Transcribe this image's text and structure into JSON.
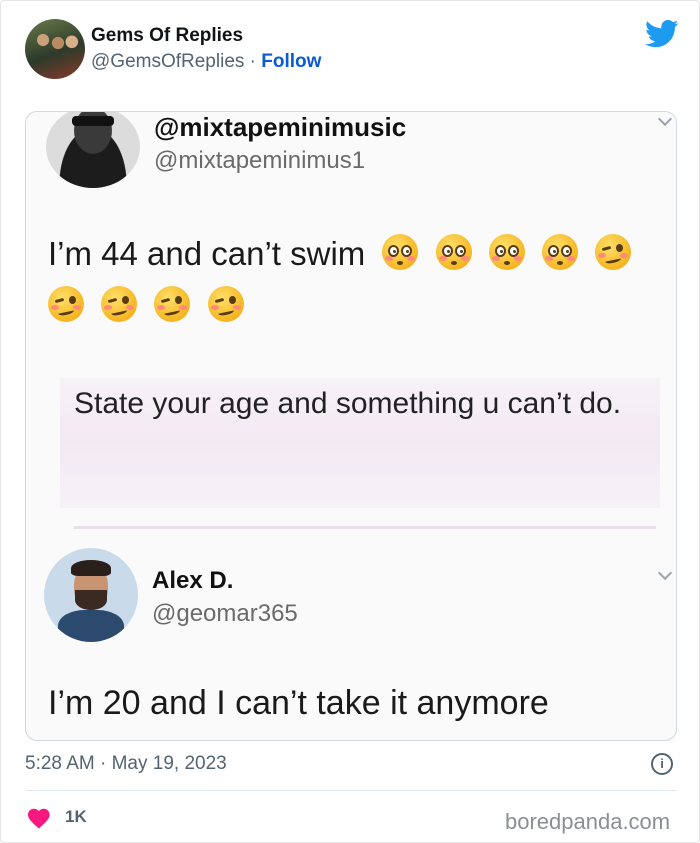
{
  "header": {
    "display_name": "Gems Of Replies",
    "handle": "@GemsOfReplies",
    "separator": " · ",
    "follow_label": "Follow"
  },
  "embedded_screenshot": {
    "first_reply": {
      "display_name": "@mixtapeminimusic",
      "handle": "@mixtapeminimus1",
      "text": "I’m 44 and can’t swim",
      "emojis": [
        "flushed",
        "flushed",
        "flushed",
        "flushed",
        "woozy",
        "woozy",
        "woozy",
        "woozy",
        "woozy"
      ]
    },
    "quoted_prompt": "State your age and something u can’t do.",
    "second_reply": {
      "display_name": "Alex D.",
      "handle": "@geomar365",
      "text": "I’m 20 and I can’t take it anymore"
    }
  },
  "footer": {
    "timestamp": "5:28 AM · May 19, 2023",
    "info_symbol": "i",
    "like_count": "1K",
    "watermark": "boredpanda.com"
  },
  "colors": {
    "twitter_blue": "#1d9bf0",
    "follow_blue": "#0a5ad4",
    "heart_pink": "#f91880",
    "secondary_text": "#536471"
  }
}
